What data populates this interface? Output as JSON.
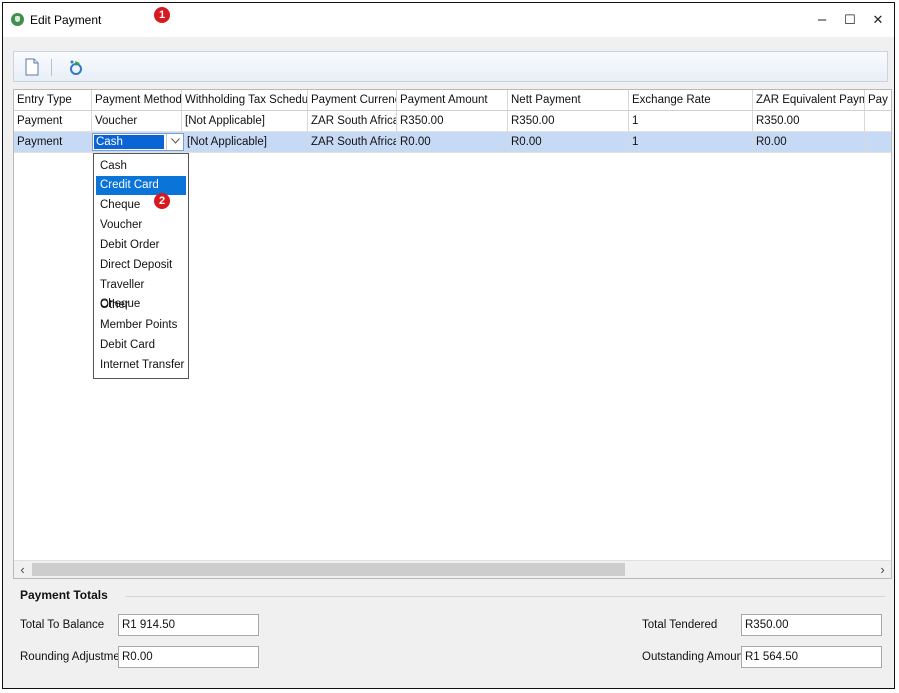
{
  "window": {
    "title": "Edit Payment",
    "buttons": {
      "minimize": "–",
      "maximize": "☐",
      "close": "✕"
    }
  },
  "annotations": [
    "1",
    "2"
  ],
  "toolbar": {
    "items": [
      {
        "name": "new-document-icon"
      },
      {
        "name": "refresh-icon"
      }
    ]
  },
  "grid": {
    "columns": [
      "Entry Type",
      "Payment Method",
      "Withholding Tax Schedule",
      "Payment Currency",
      "Payment Amount",
      "Nett Payment",
      "Exchange Rate",
      "ZAR Equivalent Payment",
      "Pay"
    ],
    "rows": [
      [
        "Payment",
        "Voucher",
        "[Not Applicable]",
        "ZAR South African r",
        "R350.00",
        "R350.00",
        "1",
        "R350.00",
        ""
      ],
      [
        "Payment",
        "Cash",
        "[Not Applicable]",
        "ZAR South African r",
        "R0.00",
        "R0.00",
        "1",
        "R0.00",
        ""
      ]
    ],
    "selected_row": 1
  },
  "payment_method_dropdown": {
    "selected": "Cash",
    "highlighted": "Credit Card",
    "options": [
      "Cash",
      "Credit Card",
      "Cheque",
      "Voucher",
      "Debit Order",
      "Direct Deposit",
      "Traveller Cheque",
      "Other",
      "Member Points",
      "Debit Card",
      "Internet Transfer"
    ]
  },
  "scrollbar": {
    "left_arrow": "‹",
    "right_arrow": "›"
  },
  "totals": {
    "title": "Payment Totals",
    "total_to_balance_label": "Total To Balance",
    "total_to_balance": "R1 914.50",
    "rounding_adjustment_label": "Rounding Adjustment",
    "rounding_adjustment": "R0.00",
    "total_tendered_label": "Total Tendered",
    "total_tendered": "R350.00",
    "outstanding_amount_label": "Outstanding Amount",
    "outstanding_amount": "R1 564.50"
  },
  "colors": {
    "selection": "#0a74d9",
    "selected_row": "#c6daf5",
    "badge": "#d71920"
  }
}
